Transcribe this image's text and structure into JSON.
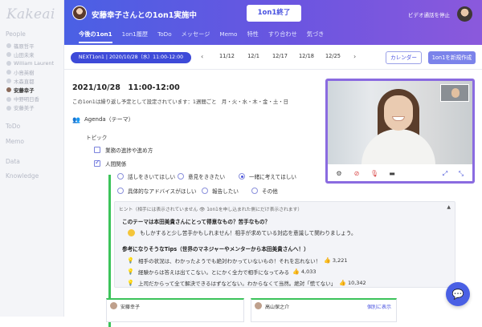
{
  "sidebar": {
    "logo": "Kakeai",
    "people_label": "People",
    "people": [
      {
        "name": "篠原哲平",
        "active": false
      },
      {
        "name": "山田未来",
        "active": false
      },
      {
        "name": "William Laurent",
        "active": false
      },
      {
        "name": "小島英樹",
        "active": false
      },
      {
        "name": "木森直都",
        "active": false
      },
      {
        "name": "安藤幸子",
        "active": true
      },
      {
        "name": "中野明日香",
        "active": false
      },
      {
        "name": "安藤美子",
        "active": false
      }
    ],
    "todo_label": "ToDo",
    "memo_label": "Memo",
    "data_label": "Data",
    "knowledge_label": "Knowledge"
  },
  "header": {
    "title": "安藤幸子さんとの1on1実施中",
    "end_button": "1on1終了",
    "video_stop": "ビデオ通話を停止",
    "tabs": [
      "今後の1on1",
      "1on1履歴",
      "ToDo",
      "メッセージ",
      "Memo",
      "特性",
      "すり合わせ",
      "気づき"
    ]
  },
  "session": {
    "next_label": "NEXT1on1 | 2020/10/28（水）11:00-12:00",
    "prev_arrow": "‹",
    "next_arrow": "›",
    "dates": [
      "11/12",
      "12/1",
      "12/17",
      "12/18",
      "12/25"
    ],
    "calendar_button": "カレンダー",
    "new_button": "1on1を新規作成"
  },
  "main": {
    "date": "2021/10/28　11:00-12:00",
    "note": "この1on1は繰り返し予定として設定されています：1週間ごと　月・火・水・木・金・土・日",
    "agenda_label": "Agenda（テーマ）",
    "topic_label": "トピック",
    "topics": [
      {
        "label": "業務の進捗や進め方",
        "checked": false
      },
      {
        "label": "人間関係",
        "checked": true
      }
    ],
    "radios": [
      {
        "label": "話しをきいてほしい",
        "on": false
      },
      {
        "label": "意見をききたい",
        "on": false
      },
      {
        "label": "一緒に考えてほしい",
        "on": true
      },
      {
        "label": "具体的なアドバイスがほしい",
        "on": false
      },
      {
        "label": "報告したい",
        "on": false
      },
      {
        "label": "その他",
        "on": false
      }
    ],
    "hint": {
      "header": "ヒント（相手には表示されていません 👁 1on1を申し込まれた側にだけ表示されます）",
      "question": "このテーマは本田美貴さんにとって得意なもの？苦手なもの？",
      "answer": "もしかすると少し苦手かもしれません！相手が求めている対応を意識して関わりましょう。",
      "tips_title": "参考になりそうなTips（世界のマネジャーやメンターから本田美貴さんへ！）",
      "tips": [
        {
          "text": "相手の状況は、わかったようでも絶対わかっていないもの！それを忘れない！",
          "likes": "3,221"
        },
        {
          "text": "経験からは答えは出てこない。とにかく全力で相手になってみる",
          "likes": "4,033"
        },
        {
          "text": "上司だからって全て解決できるはずなどない。わからなくて当然。絶対「慌てない」",
          "likes": "10,342"
        }
      ]
    },
    "cards": [
      {
        "name": "安藤幸子"
      },
      {
        "name": "高山保之介",
        "action": "個別に表示"
      }
    ]
  },
  "video": {
    "controls": [
      "gear-icon",
      "camera-off-icon",
      "mic-off-icon",
      "screen-share-icon",
      "expand-icon",
      "shrink-icon"
    ]
  },
  "colors": {
    "accent": "#4a53e0",
    "header_start": "#4a60e4",
    "header_end": "#8b59dc",
    "green": "#3cc35a"
  }
}
